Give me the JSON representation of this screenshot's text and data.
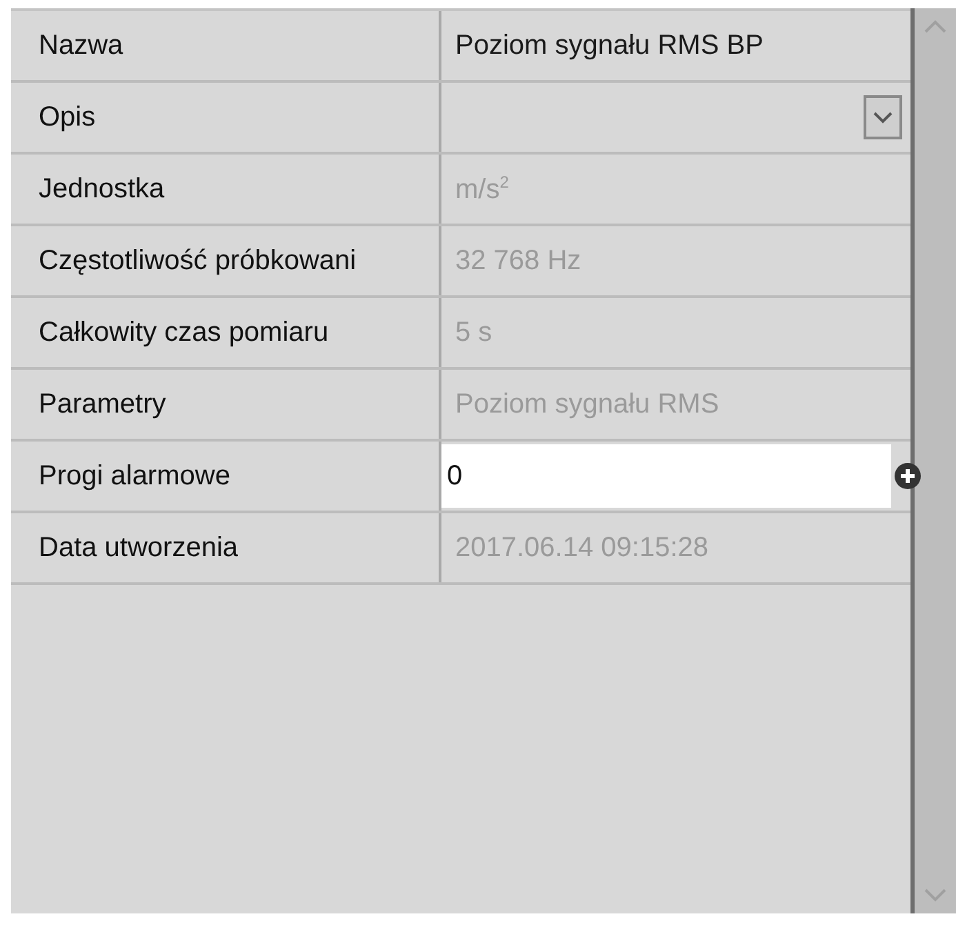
{
  "properties": [
    {
      "label": "Nazwa",
      "kind": "text",
      "value": "Poziom sygnału RMS BP",
      "disabled": false
    },
    {
      "label": "Opis",
      "kind": "dropdown",
      "disabled": false
    },
    {
      "label": "Jednostka",
      "kind": "text",
      "value": "m/s$^{2}$",
      "disabled": true
    },
    {
      "label": "Częstotliwość próbkowani",
      "kind": "text",
      "value": "32 768 Hz",
      "disabled": true
    },
    {
      "label": "Całkowity czas pomiaru",
      "kind": "text",
      "value": "5 s",
      "disabled": true
    },
    {
      "label": "Parametry",
      "kind": "text",
      "value": "Poziom sygnału RMS",
      "disabled": true
    },
    {
      "label": "Progi alarmowe",
      "kind": "input",
      "value": "0",
      "disabled": false
    },
    {
      "label": "Data utworzenia",
      "kind": "text",
      "value": "2017.06.14 09:15:28",
      "disabled": true
    }
  ]
}
